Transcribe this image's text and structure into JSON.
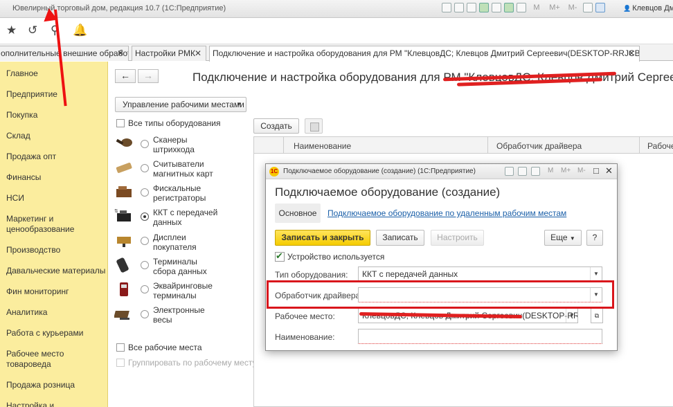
{
  "window": {
    "title": "Ювелирный торговый дом, редакция 10.7  (1С:Предприятие)",
    "user": "Клевцов Дмитрий",
    "toolbar_m": [
      "M",
      "M+",
      "M-"
    ]
  },
  "toolbar2": {
    "icons": [
      "star-icon",
      "history-icon",
      "search-icon",
      "bell-icon"
    ]
  },
  "tabs": [
    {
      "label": "ополнительные внешние обработки",
      "close": "✕"
    },
    {
      "label": "Настройки РМК",
      "close": "✕"
    },
    {
      "label": "Подключение и настройка оборудования для РМ \"КлевцовДС; Клевцов Дмитрий Сергеевич(DESKTOP-RRJCBSK)\"",
      "close": "✕"
    }
  ],
  "sidebar": {
    "items": [
      "Главное",
      "Предприятие",
      "Покупка",
      "Склад",
      "Продажа опт",
      "Финансы",
      "НСИ",
      "Маркетинг и ценообразование",
      "Производство",
      "Давальческие материалы",
      "Фин мониторинг",
      "Аналитика",
      "Работа с курьерами",
      "Рабочее место товароведа",
      "Продажа розница",
      "Настройка и"
    ]
  },
  "main": {
    "nav_back": "←",
    "nav_forward": "→",
    "title": "Подключение и настройка оборудования для РМ \"КлевцовДС; Клевцов Дмитрий Сергеевич",
    "manage_btn": "Управление рабочими местами",
    "all_types": "Все типы оборудования",
    "equipment": [
      {
        "line1": "Сканеры",
        "line2": "штрихкода",
        "icon": "barcode-scanner-icon"
      },
      {
        "line1": "Считыватели",
        "line2": "магнитных карт",
        "icon": "card-reader-icon"
      },
      {
        "line1": "Фискальные",
        "line2": "регистраторы",
        "icon": "fiscal-register-icon"
      },
      {
        "line1": "ККТ с передачей",
        "line2": "данных",
        "icon": "kkt-icon"
      },
      {
        "line1": "Дисплеи",
        "line2": "покупателя",
        "icon": "customer-display-icon"
      },
      {
        "line1": "Терминалы",
        "line2": "сбора данных",
        "icon": "data-terminal-icon"
      },
      {
        "line1": "Эквайринговые",
        "line2": "терминалы",
        "icon": "acquiring-terminal-icon"
      },
      {
        "line1": "Электронные",
        "line2": "весы",
        "icon": "scales-icon"
      }
    ],
    "all_workplaces": "Все рабочие места",
    "group_by": "Группировать по рабочему месту",
    "create_btn": "Создать",
    "columns": [
      "Наименование",
      "Обработчик драйвера",
      "Рабоче"
    ]
  },
  "modal": {
    "window_title": "Подключаемое оборудование (создание)  (1С:Предприятие)",
    "logo": "1С",
    "m_labels": [
      "M",
      "M+",
      "M-"
    ],
    "header": "Подключаемое оборудование (создание)",
    "tab_main": "Основное",
    "tab_link": "Подключаемое оборудование по удаленным рабочим местам",
    "btn_save_close": "Записать и закрыть",
    "btn_save": "Записать",
    "btn_configure": "Настроить",
    "btn_more": "Еще",
    "btn_help": "?",
    "device_used": "Устройство используется",
    "type_label": "Тип оборудования:",
    "type_value": "ККТ с передачей данных",
    "driver_label": "Обработчик драйвера:",
    "driver_value": "",
    "workplace_label": "Рабочее место:",
    "workplace_value": "КлевцовДС; Клевцов Дмитрий Сергеевич(DESKTOP-RRJCB",
    "name_label": "Наименование:",
    "name_value": ""
  },
  "colors": {
    "sidebar": "#fbed9e",
    "primary_button": "#f5cc00",
    "highlight": "#d9161c",
    "link": "#1a5fa8"
  }
}
